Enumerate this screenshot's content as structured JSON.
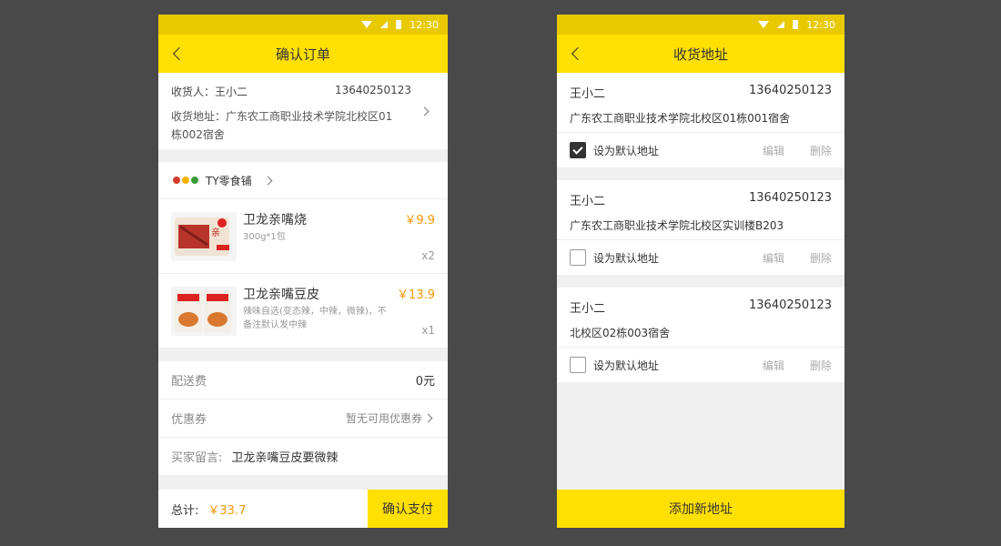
{
  "status": {
    "time": "12:30"
  },
  "order": {
    "title": "确认订单",
    "receiver_label": "收货人：",
    "receiver_name": "王小二",
    "receiver_phone": "13640250123",
    "address_label": "收货地址：",
    "address": "广东农工商职业技术学院北校区01栋002宿舍",
    "shop_name": "TY零食铺",
    "items": [
      {
        "name": "卫龙亲嘴烧",
        "spec": "300g*1包",
        "price": "￥9.9",
        "qty": "x2"
      },
      {
        "name": "卫龙亲嘴豆皮",
        "spec": "辣味自选(变态辣，中辣，微辣)，不备注默认发中辣",
        "price": "￥13.9",
        "qty": "x1"
      }
    ],
    "delivery_label": "配送费",
    "delivery_value": "0元",
    "coupon_label": "优惠券",
    "coupon_value": "暂无可用优惠券",
    "message_label": "买家留言:",
    "message_value": "卫龙亲嘴豆皮要微辣",
    "total_label": "总计:",
    "total_value": "￥33.7",
    "pay_button": "确认支付"
  },
  "addresses": {
    "title": "收货地址",
    "default_label": "设为默认地址",
    "edit_label": "编辑",
    "delete_label": "删除",
    "list": [
      {
        "name": "王小二",
        "phone": "13640250123",
        "address": "广东农工商职业技术学院北校区01栋001宿舍",
        "is_default": true
      },
      {
        "name": "王小二",
        "phone": "13640250123",
        "address": "广东农工商职业技术学院北校区实训楼B203",
        "is_default": false
      },
      {
        "name": "王小二",
        "phone": "13640250123",
        "address": "北校区02栋003宿舍",
        "is_default": false
      }
    ],
    "add_button": "添加新地址"
  },
  "colors": {
    "brand_yellow": "#ffe000",
    "price_orange": "#f39800"
  }
}
